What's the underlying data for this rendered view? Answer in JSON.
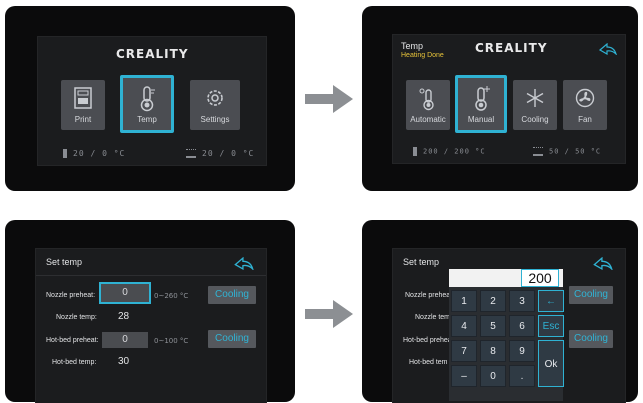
{
  "panel1": {
    "logo": "CREALITY",
    "tiles": [
      {
        "label": "Print",
        "icon": "print-icon"
      },
      {
        "label": "Temp",
        "icon": "thermometer-icon"
      },
      {
        "label": "Settings",
        "icon": "gear-icon"
      }
    ],
    "nozzle_status": "20 / 0 °C",
    "bed_status": "20 / 0 °C"
  },
  "panel2": {
    "title": "Temp",
    "subtitle": "Heating Done",
    "logo": "CREALITY",
    "back_icon": "back-arrow-icon",
    "tiles": [
      {
        "label": "Automatic",
        "icon": "thermometer-auto-icon"
      },
      {
        "label": "Manual",
        "icon": "thermometer-plus-icon"
      },
      {
        "label": "Cooling",
        "icon": "snowflake-icon"
      },
      {
        "label": "Fan",
        "icon": "fan-icon"
      }
    ],
    "nozzle_status": "200 / 200 °C",
    "bed_status": "50 / 50 °C"
  },
  "panel3": {
    "title": "Set temp",
    "nozzle_preheat_label": "Nozzle preheat:",
    "nozzle_preheat_value": "0",
    "nozzle_range": "0~260 °C",
    "nozzle_temp_label": "Nozzle temp:",
    "nozzle_temp_value": "28",
    "bed_preheat_label": "Hot-bed preheat:",
    "bed_preheat_value": "0",
    "bed_range": "0~100 °C",
    "bed_temp_label": "Hot-bed temp:",
    "bed_temp_value": "30",
    "cooling_label": "Cooling"
  },
  "panel4": {
    "title": "Set temp",
    "input_value": "200",
    "nozzle_preheat_label": "Nozzle prehea",
    "nozzle_temp_label": "Nozzle tem",
    "bed_preheat_label": "Hot-bed prehea",
    "bed_temp_label": "Hot-bed tem",
    "cooling_label": "Cooling",
    "keys": [
      "1",
      "2",
      "3",
      "←",
      "4",
      "5",
      "6",
      "Esc",
      "7",
      "8",
      "9",
      "–",
      "0",
      "."
    ],
    "ok_label": "Ok"
  },
  "colors": {
    "accent": "#2fb2d3",
    "tile": "#4b4d52",
    "screen": "#1b1c1e",
    "heating_done": "#e7c33a"
  }
}
